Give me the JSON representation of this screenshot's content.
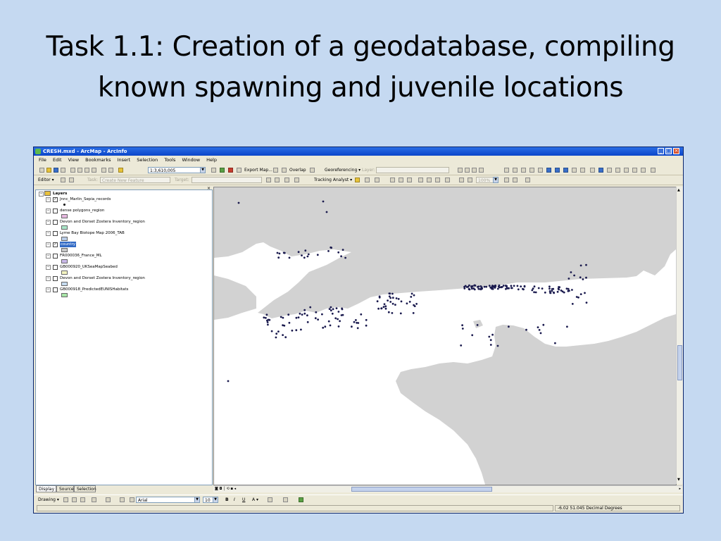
{
  "slide": {
    "title_line1": "Task 1.1: Creation of a geodatabase, compiling",
    "title_line2": "known spawning and juvenile locations"
  },
  "window": {
    "title": "CRESH.mxd - ArcMap - ArcInfo",
    "menu": [
      "File",
      "Edit",
      "View",
      "Bookmarks",
      "Insert",
      "Selection",
      "Tools",
      "Window",
      "Help"
    ]
  },
  "toolbar1": {
    "scale": "1:3,610,005",
    "export_map": "Export Map...",
    "overlap": "Overlap",
    "georeferencing": "Georeferencing ▾",
    "layer_label": "Layer:"
  },
  "toolbar2": {
    "editor": "Editor ▾",
    "task_label": "Task:",
    "task_value": "Create New Feature",
    "target_label": "Target:",
    "tracking_analyst": "Tracking Analyst ▾",
    "zoom_value": "100%"
  },
  "toc": {
    "root": "Layers",
    "layers": [
      {
        "name": "Jnnc_Marlin_Sepia_records",
        "checked": true,
        "swatch_color": "#000000",
        "swatch_type": "point"
      },
      {
        "name": "dense polygons_region",
        "checked": false,
        "swatch_color": "#e6b8e0",
        "swatch_type": "fill"
      },
      {
        "name": "Devon and Dorset Zostera Inventory_region",
        "checked": false,
        "swatch_color": "#a9e6c8",
        "swatch_type": "fill"
      },
      {
        "name": "Lyme Bay Biotope Map 2006_TAB",
        "checked": false,
        "swatch_color": "#b9cde8",
        "swatch_type": "fill"
      },
      {
        "name": "country",
        "checked": true,
        "selected": true,
        "swatch_color": "#c8c8c8",
        "swatch_type": "fill"
      },
      {
        "name": "FR000036_France_ML",
        "checked": false,
        "swatch_color": "#c9b8e8",
        "swatch_type": "fill"
      },
      {
        "name": "GB000920_UKSeaMapSeabed",
        "checked": false,
        "swatch_color": "#f2f2c0",
        "swatch_type": "fill"
      },
      {
        "name": "Devon and Dorset Zostera Inventory_region",
        "checked": false,
        "swatch_color": "#c6dcf0",
        "swatch_type": "fill"
      },
      {
        "name": "GB000918_PredictedEUNISHabitats",
        "checked": false,
        "swatch_color": "#a8e6a8",
        "swatch_type": "fill"
      }
    ],
    "tabs": [
      "Display",
      "Source",
      "Selection"
    ]
  },
  "drawing_toolbar": {
    "drawing": "Drawing ▾",
    "font": "Arial",
    "font_size": "10"
  },
  "status": {
    "coords": "-6.02  51.045 Decimal Degrees"
  },
  "map": {
    "land_color": "#d2d2d2",
    "sea_color": "#ffffff",
    "point_color": "#1a1a4e"
  }
}
